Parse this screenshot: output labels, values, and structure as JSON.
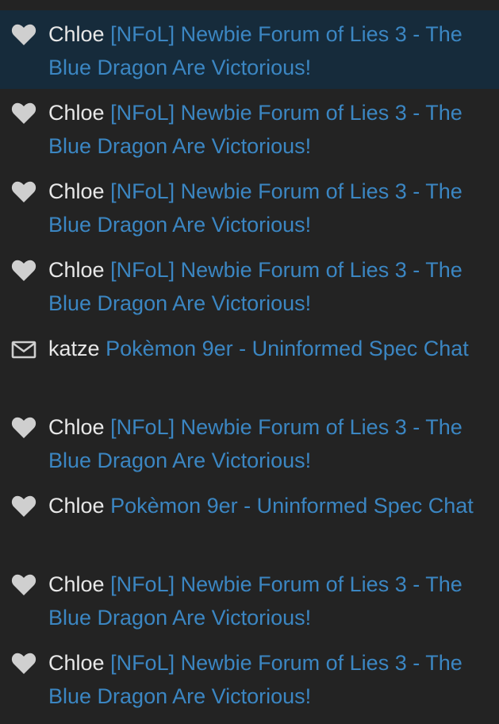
{
  "theme": {
    "background": "#232323",
    "selected_background": "#162b3b",
    "username_color": "#e8e8e8",
    "link_color": "#3b86c2",
    "icon_color": "#cfcfcf"
  },
  "notifications": [
    {
      "icon": "heart-icon",
      "user": "Chloe",
      "thread": "[NFoL] Newbie Forum of Lies 3 - The Blue Dragon Are Victorious!",
      "selected": true
    },
    {
      "icon": "heart-icon",
      "user": "Chloe",
      "thread": "[NFoL] Newbie Forum of Lies 3 - The Blue Dragon Are Victorious!",
      "selected": false
    },
    {
      "icon": "heart-icon",
      "user": "Chloe",
      "thread": "[NFoL] Newbie Forum of Lies 3 - The Blue Dragon Are Victorious!",
      "selected": false
    },
    {
      "icon": "heart-icon",
      "user": "Chloe",
      "thread": "[NFoL] Newbie Forum of Lies 3 - The Blue Dragon Are Victorious!",
      "selected": false
    },
    {
      "icon": "envelope-icon",
      "user": "katze",
      "thread": "Pokèmon 9er - Uninformed Spec Chat",
      "selected": false
    },
    {
      "icon": "heart-icon",
      "user": "Chloe",
      "thread": "[NFoL] Newbie Forum of Lies 3 - The Blue Dragon Are Victorious!",
      "selected": false
    },
    {
      "icon": "heart-icon",
      "user": "Chloe",
      "thread": "Pokèmon 9er - Uninformed Spec Chat",
      "selected": false
    },
    {
      "icon": "heart-icon",
      "user": "Chloe",
      "thread": "[NFoL] Newbie Forum of Lies 3 - The Blue Dragon Are Victorious!",
      "selected": false
    },
    {
      "icon": "heart-icon",
      "user": "Chloe",
      "thread": "[NFoL] Newbie Forum of Lies 3 - The Blue Dragon Are Victorious!",
      "selected": false
    }
  ]
}
